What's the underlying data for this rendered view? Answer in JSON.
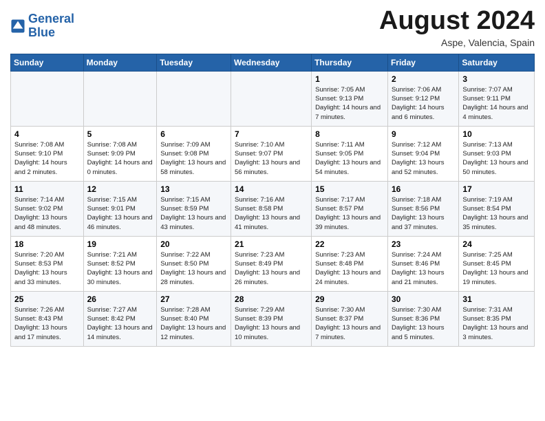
{
  "header": {
    "logo_line1": "General",
    "logo_line2": "Blue",
    "month": "August 2024",
    "location": "Aspe, Valencia, Spain"
  },
  "days_of_week": [
    "Sunday",
    "Monday",
    "Tuesday",
    "Wednesday",
    "Thursday",
    "Friday",
    "Saturday"
  ],
  "weeks": [
    [
      {
        "day": "",
        "info": ""
      },
      {
        "day": "",
        "info": ""
      },
      {
        "day": "",
        "info": ""
      },
      {
        "day": "",
        "info": ""
      },
      {
        "day": "1",
        "sunrise": "7:05 AM",
        "sunset": "9:13 PM",
        "daylight": "14 hours and 7 minutes."
      },
      {
        "day": "2",
        "sunrise": "7:06 AM",
        "sunset": "9:12 PM",
        "daylight": "14 hours and 6 minutes."
      },
      {
        "day": "3",
        "sunrise": "7:07 AM",
        "sunset": "9:11 PM",
        "daylight": "14 hours and 4 minutes."
      }
    ],
    [
      {
        "day": "4",
        "sunrise": "7:08 AM",
        "sunset": "9:10 PM",
        "daylight": "14 hours and 2 minutes."
      },
      {
        "day": "5",
        "sunrise": "7:08 AM",
        "sunset": "9:09 PM",
        "daylight": "14 hours and 0 minutes."
      },
      {
        "day": "6",
        "sunrise": "7:09 AM",
        "sunset": "9:08 PM",
        "daylight": "13 hours and 58 minutes."
      },
      {
        "day": "7",
        "sunrise": "7:10 AM",
        "sunset": "9:07 PM",
        "daylight": "13 hours and 56 minutes."
      },
      {
        "day": "8",
        "sunrise": "7:11 AM",
        "sunset": "9:05 PM",
        "daylight": "13 hours and 54 minutes."
      },
      {
        "day": "9",
        "sunrise": "7:12 AM",
        "sunset": "9:04 PM",
        "daylight": "13 hours and 52 minutes."
      },
      {
        "day": "10",
        "sunrise": "7:13 AM",
        "sunset": "9:03 PM",
        "daylight": "13 hours and 50 minutes."
      }
    ],
    [
      {
        "day": "11",
        "sunrise": "7:14 AM",
        "sunset": "9:02 PM",
        "daylight": "13 hours and 48 minutes."
      },
      {
        "day": "12",
        "sunrise": "7:15 AM",
        "sunset": "9:01 PM",
        "daylight": "13 hours and 46 minutes."
      },
      {
        "day": "13",
        "sunrise": "7:15 AM",
        "sunset": "8:59 PM",
        "daylight": "13 hours and 43 minutes."
      },
      {
        "day": "14",
        "sunrise": "7:16 AM",
        "sunset": "8:58 PM",
        "daylight": "13 hours and 41 minutes."
      },
      {
        "day": "15",
        "sunrise": "7:17 AM",
        "sunset": "8:57 PM",
        "daylight": "13 hours and 39 minutes."
      },
      {
        "day": "16",
        "sunrise": "7:18 AM",
        "sunset": "8:56 PM",
        "daylight": "13 hours and 37 minutes."
      },
      {
        "day": "17",
        "sunrise": "7:19 AM",
        "sunset": "8:54 PM",
        "daylight": "13 hours and 35 minutes."
      }
    ],
    [
      {
        "day": "18",
        "sunrise": "7:20 AM",
        "sunset": "8:53 PM",
        "daylight": "13 hours and 33 minutes."
      },
      {
        "day": "19",
        "sunrise": "7:21 AM",
        "sunset": "8:52 PM",
        "daylight": "13 hours and 30 minutes."
      },
      {
        "day": "20",
        "sunrise": "7:22 AM",
        "sunset": "8:50 PM",
        "daylight": "13 hours and 28 minutes."
      },
      {
        "day": "21",
        "sunrise": "7:23 AM",
        "sunset": "8:49 PM",
        "daylight": "13 hours and 26 minutes."
      },
      {
        "day": "22",
        "sunrise": "7:23 AM",
        "sunset": "8:48 PM",
        "daylight": "13 hours and 24 minutes."
      },
      {
        "day": "23",
        "sunrise": "7:24 AM",
        "sunset": "8:46 PM",
        "daylight": "13 hours and 21 minutes."
      },
      {
        "day": "24",
        "sunrise": "7:25 AM",
        "sunset": "8:45 PM",
        "daylight": "13 hours and 19 minutes."
      }
    ],
    [
      {
        "day": "25",
        "sunrise": "7:26 AM",
        "sunset": "8:43 PM",
        "daylight": "13 hours and 17 minutes."
      },
      {
        "day": "26",
        "sunrise": "7:27 AM",
        "sunset": "8:42 PM",
        "daylight": "13 hours and 14 minutes."
      },
      {
        "day": "27",
        "sunrise": "7:28 AM",
        "sunset": "8:40 PM",
        "daylight": "13 hours and 12 minutes."
      },
      {
        "day": "28",
        "sunrise": "7:29 AM",
        "sunset": "8:39 PM",
        "daylight": "13 hours and 10 minutes."
      },
      {
        "day": "29",
        "sunrise": "7:30 AM",
        "sunset": "8:37 PM",
        "daylight": "13 hours and 7 minutes."
      },
      {
        "day": "30",
        "sunrise": "7:30 AM",
        "sunset": "8:36 PM",
        "daylight": "13 hours and 5 minutes."
      },
      {
        "day": "31",
        "sunrise": "7:31 AM",
        "sunset": "8:35 PM",
        "daylight": "13 hours and 3 minutes."
      }
    ]
  ]
}
